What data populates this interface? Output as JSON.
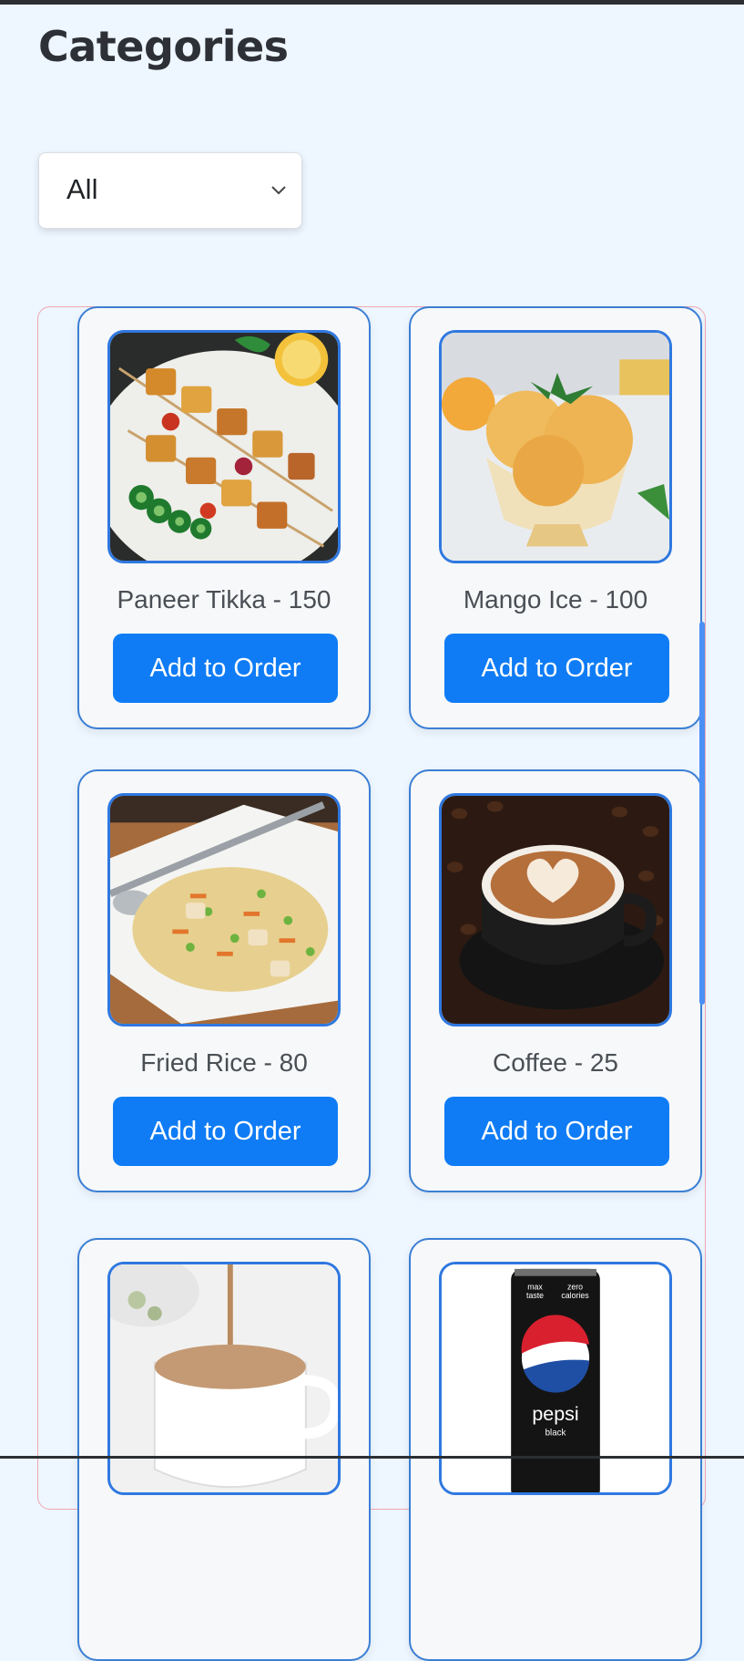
{
  "page": {
    "title": "Categories"
  },
  "filter": {
    "selected": "All"
  },
  "items": [
    {
      "name": "Paneer Tikka - 150",
      "button": "Add to Order",
      "image": "paneer-tikka-skewers"
    },
    {
      "name": "Mango Ice - 100",
      "button": "Add to Order",
      "image": "mango-ice-cream-bowl"
    },
    {
      "name": "Fried Rice - 80",
      "button": "Add to Order",
      "image": "fried-rice-plate"
    },
    {
      "name": "Coffee - 25",
      "button": "Add to Order",
      "image": "coffee-cup-latte-art"
    },
    {
      "name": "",
      "button": "",
      "image": "tea-cup-pour"
    },
    {
      "name": "",
      "button": "",
      "image": "pepsi-black-can"
    }
  ],
  "colors": {
    "background": "#eef6ff",
    "accent": "#0f7cf5",
    "card_border": "#3a7fd4"
  }
}
